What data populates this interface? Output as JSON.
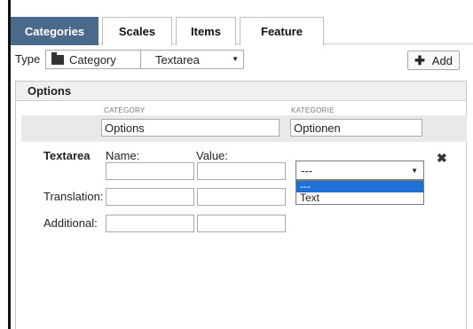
{
  "tabs": [
    {
      "label": "Categories",
      "active": true
    },
    {
      "label": "Scales",
      "active": false
    },
    {
      "label": "Items",
      "active": false
    },
    {
      "label": "Feature",
      "active": false
    }
  ],
  "type_row": {
    "label": "Type",
    "category_button": "Category",
    "type_select": "Textarea",
    "add_button": "Add"
  },
  "options": {
    "title": "Options",
    "col_headers": [
      "CATEGORY",
      "KATEGORIE"
    ],
    "category_values": [
      "Options",
      "Optionen"
    ]
  },
  "textarea_row": {
    "label": "Textarea",
    "name_label": "Name:",
    "value_label": "Value:",
    "translation_label": "Translation:",
    "additional_label": "Additional:",
    "dropdown_selected": "---",
    "dropdown_options": [
      "---",
      "Text"
    ]
  },
  "colors": {
    "active_tab_bg": "#4a6a8c",
    "band_bg": "#ebe8e8",
    "selected_option_bg": "#1e6fd6"
  }
}
